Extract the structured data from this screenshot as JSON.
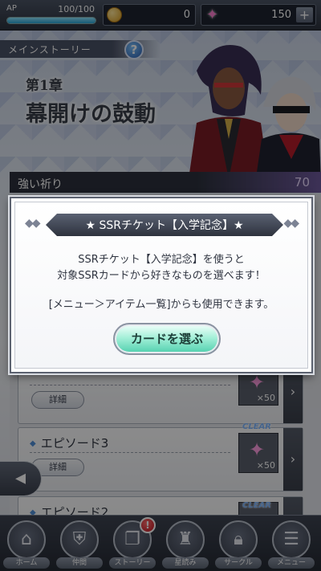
{
  "topbar": {
    "ap_label": "AP",
    "ap_value": "100/100",
    "ap_fraction": 1.0,
    "coins": "0",
    "gems": "150",
    "gem_plus": "+"
  },
  "story": {
    "header": "メインストーリー",
    "help": "?",
    "chapter_num": "第1章",
    "chapter_title": "幕開けの鼓動"
  },
  "prayer": {
    "label": "強い祈り",
    "value": "70"
  },
  "episodes": [
    {
      "title": "",
      "detail": "詳細",
      "reward": "×50",
      "clear": "CLEAR"
    },
    {
      "title": "エピソード3",
      "detail": "詳細",
      "reward": "×50",
      "clear": "CLEAR"
    },
    {
      "title": "エピソード2",
      "detail": "",
      "reward": "",
      "clear": "CLEAR"
    }
  ],
  "nav": [
    {
      "label": "ホーム",
      "icon": "home-icon"
    },
    {
      "label": "仲間",
      "icon": "shield-sword-icon"
    },
    {
      "label": "ストーリー",
      "icon": "book-icon",
      "badge": "!"
    },
    {
      "label": "星読み",
      "icon": "castle-icon"
    },
    {
      "label": "サークル",
      "icon": "lock-icon"
    },
    {
      "label": "メニュー",
      "icon": "menu-icon"
    }
  ],
  "modal": {
    "title": "★ SSRチケット【入学記念】★",
    "line1": "SSRチケット【入学記念】を使うと",
    "line2": "対象SSRカードから好きなものを選べます！",
    "line3": "[メニュー＞アイテム一覧]からも使用できます。",
    "button": "カードを選ぶ"
  }
}
